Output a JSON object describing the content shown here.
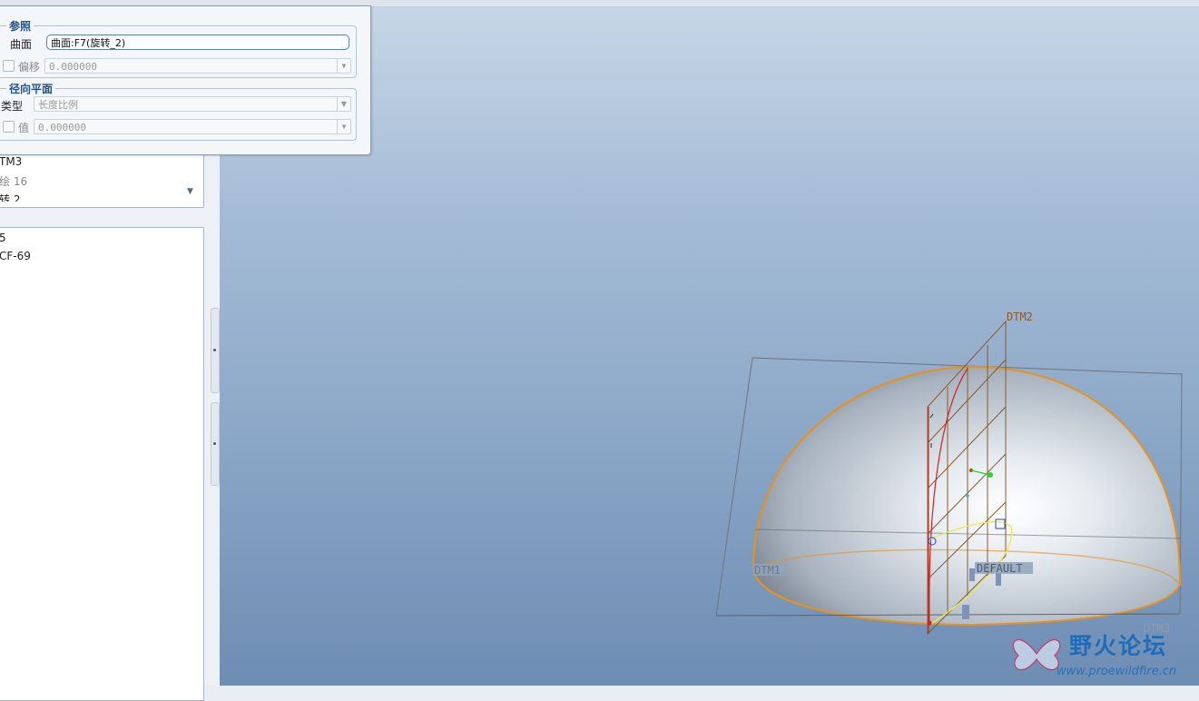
{
  "panel": {
    "references": {
      "title": "参照",
      "surface_label": "曲面",
      "surface_value": "曲面:F7(旋转_2)",
      "offset_label": "偏移",
      "offset_value": "0.000000"
    },
    "radial_plane": {
      "title": "径向平面",
      "type_label": "类型",
      "type_value": "长度比例",
      "value_label": "值",
      "value_value": "0.000000"
    }
  },
  "left_panel": {
    "upper_list": [
      "TM3",
      "绘 16",
      "转 2"
    ],
    "lower_list": [
      "5",
      "CF-69"
    ]
  },
  "viewport": {
    "datum_labels": {
      "dtm2": "DTM2",
      "dtm1": "DTM1",
      "dtm3": "DTM3",
      "csys": "DEFAULT"
    }
  },
  "watermark": {
    "title": "野火论坛",
    "url": "www.proewildfire.cn"
  },
  "colors": {
    "group_title": "#23528a",
    "surface_edge": "#e8911c",
    "datum_plane": "#8a5a2a",
    "sketch_red": "#d42020",
    "sketch_yellow": "#f2e84a"
  }
}
